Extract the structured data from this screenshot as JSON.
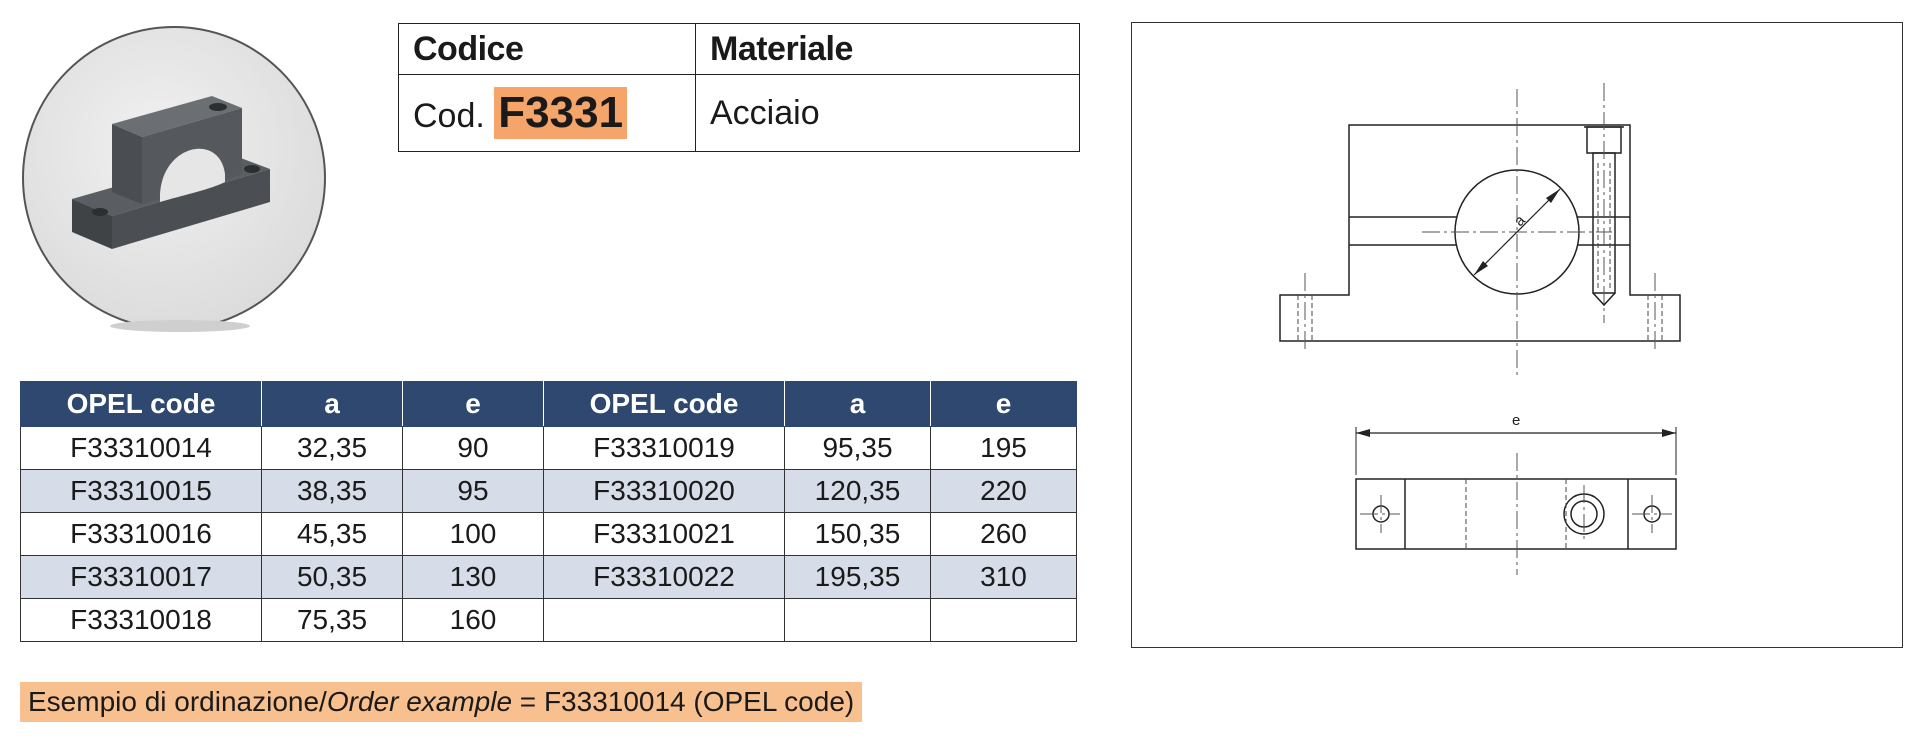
{
  "header": {
    "codice_label": "Codice",
    "materiale_label": "Materiale",
    "cod_prefix": "Cod.",
    "code": "F3331",
    "material": "Acciaio",
    "highlight_color": "#f5a46a"
  },
  "drawing": {
    "dim_a": "a",
    "dim_e": "e"
  },
  "table": {
    "headers": [
      "OPEL code",
      "a",
      "e",
      "OPEL code",
      "a",
      "e"
    ],
    "header_color": "#2f4870",
    "alt_row_color": "#d6dde8",
    "rows": [
      [
        "F33310014",
        "32,35",
        "90",
        "F33310019",
        "95,35",
        "195"
      ],
      [
        "F33310015",
        "38,35",
        "95",
        "F33310020",
        "120,35",
        "220"
      ],
      [
        "F33310016",
        "45,35",
        "100",
        "F33310021",
        "150,35",
        "260"
      ],
      [
        "F33310017",
        "50,35",
        "130",
        "F33310022",
        "195,35",
        "310"
      ],
      [
        "F33310018",
        "75,35",
        "160",
        "",
        "",
        ""
      ]
    ]
  },
  "order_example": {
    "prefix": "Esempio di ordinazione/",
    "italic": "Order example",
    "suffix": " = F33310014 (OPEL code)",
    "bg_color": "#f9c08f"
  }
}
